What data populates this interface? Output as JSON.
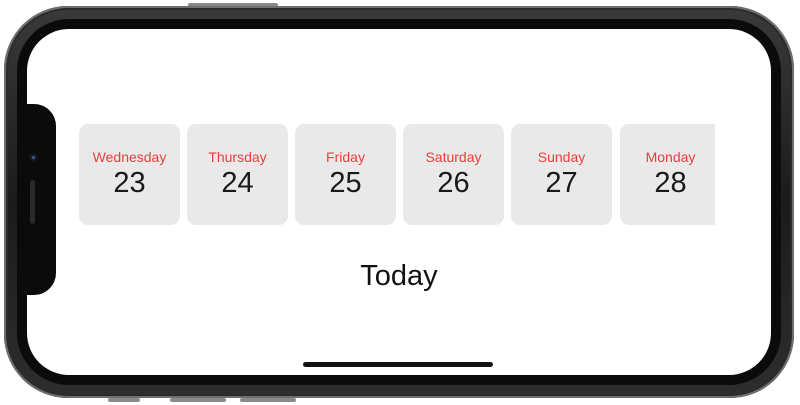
{
  "days": [
    {
      "name": "Wednesday",
      "number": "23"
    },
    {
      "name": "Thursday",
      "number": "24"
    },
    {
      "name": "Friday",
      "number": "25"
    },
    {
      "name": "Saturday",
      "number": "26"
    },
    {
      "name": "Sunday",
      "number": "27"
    },
    {
      "name": "Monday",
      "number": "28"
    }
  ],
  "main": {
    "label": "Today"
  },
  "colors": {
    "day_name": "#e8403a",
    "cell_background": "#e9e9e9",
    "text": "#1a1a1a"
  }
}
